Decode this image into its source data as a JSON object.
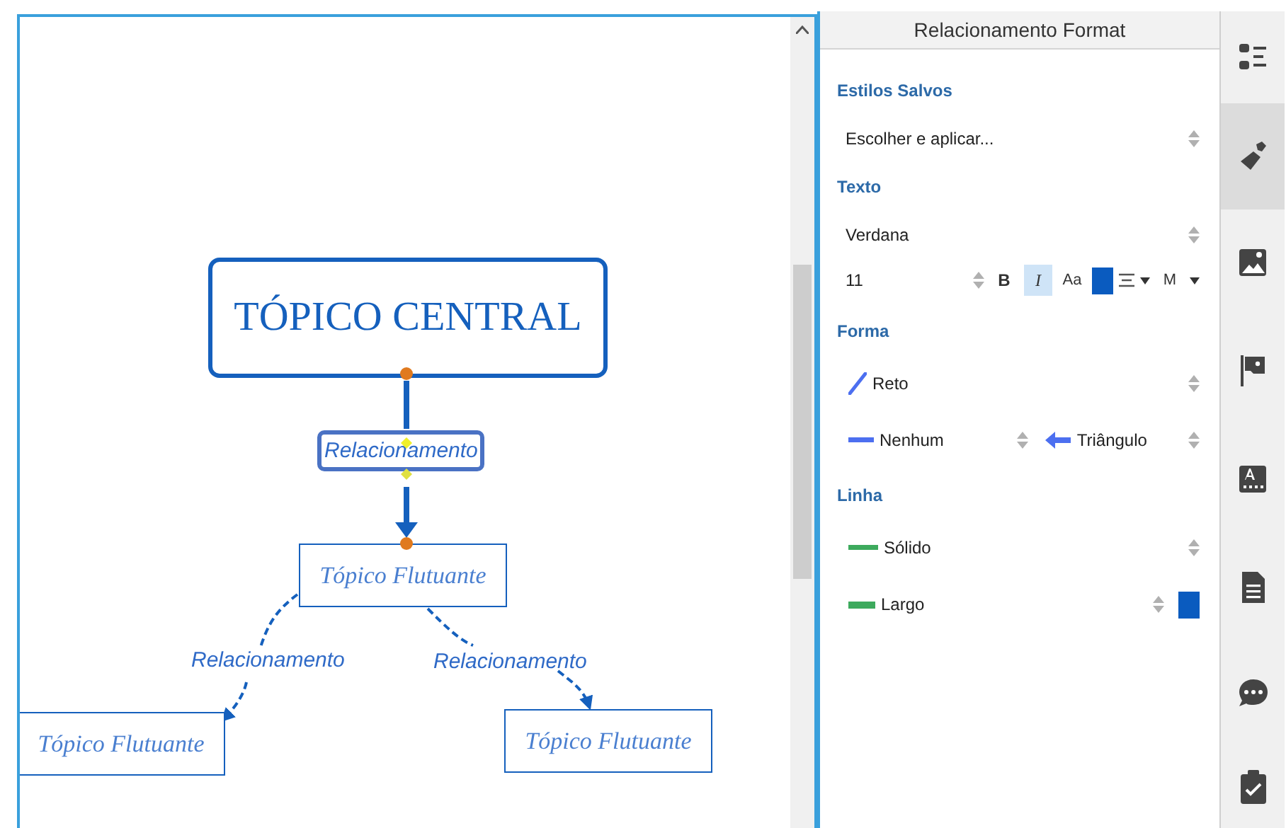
{
  "canvas": {
    "central_topic": "TÓPICO CENTRAL",
    "floating_topics": [
      {
        "label": "Tópico Flutuante"
      },
      {
        "label": "Tópico Flutuante"
      },
      {
        "label": "Tópico Flutuante"
      }
    ],
    "relationships": [
      {
        "label": "Relacionamento",
        "selected": true
      },
      {
        "label": "Relacionamento",
        "selected": false
      },
      {
        "label": "Relacionamento",
        "selected": false
      }
    ]
  },
  "panel": {
    "title": "Relacionamento Format",
    "saved_styles": {
      "heading": "Estilos Salvos",
      "value": "Escolher e aplicar..."
    },
    "text": {
      "heading": "Texto",
      "font": "Verdana",
      "size": "11",
      "bold_label": "B",
      "bold": false,
      "italic_label": "I",
      "italic": true,
      "case_label": "Aa",
      "color": "#0a5bbf",
      "weight_label": "M"
    },
    "shape": {
      "heading": "Forma",
      "line_type": "Reto",
      "start_arrow": "Nenhum",
      "end_arrow": "Triângulo"
    },
    "line": {
      "heading": "Linha",
      "style": "Sólido",
      "width": "Largo",
      "color": "#0a5bbf"
    }
  },
  "sidebar": [
    {
      "kind": "outline",
      "selected": false
    },
    {
      "kind": "format",
      "selected": true
    },
    {
      "kind": "image",
      "selected": false
    },
    {
      "kind": "marker",
      "selected": false
    },
    {
      "kind": "text-style",
      "selected": false
    },
    {
      "kind": "notes",
      "selected": false
    },
    {
      "kind": "comment",
      "selected": false
    },
    {
      "kind": "task",
      "selected": false
    }
  ]
}
